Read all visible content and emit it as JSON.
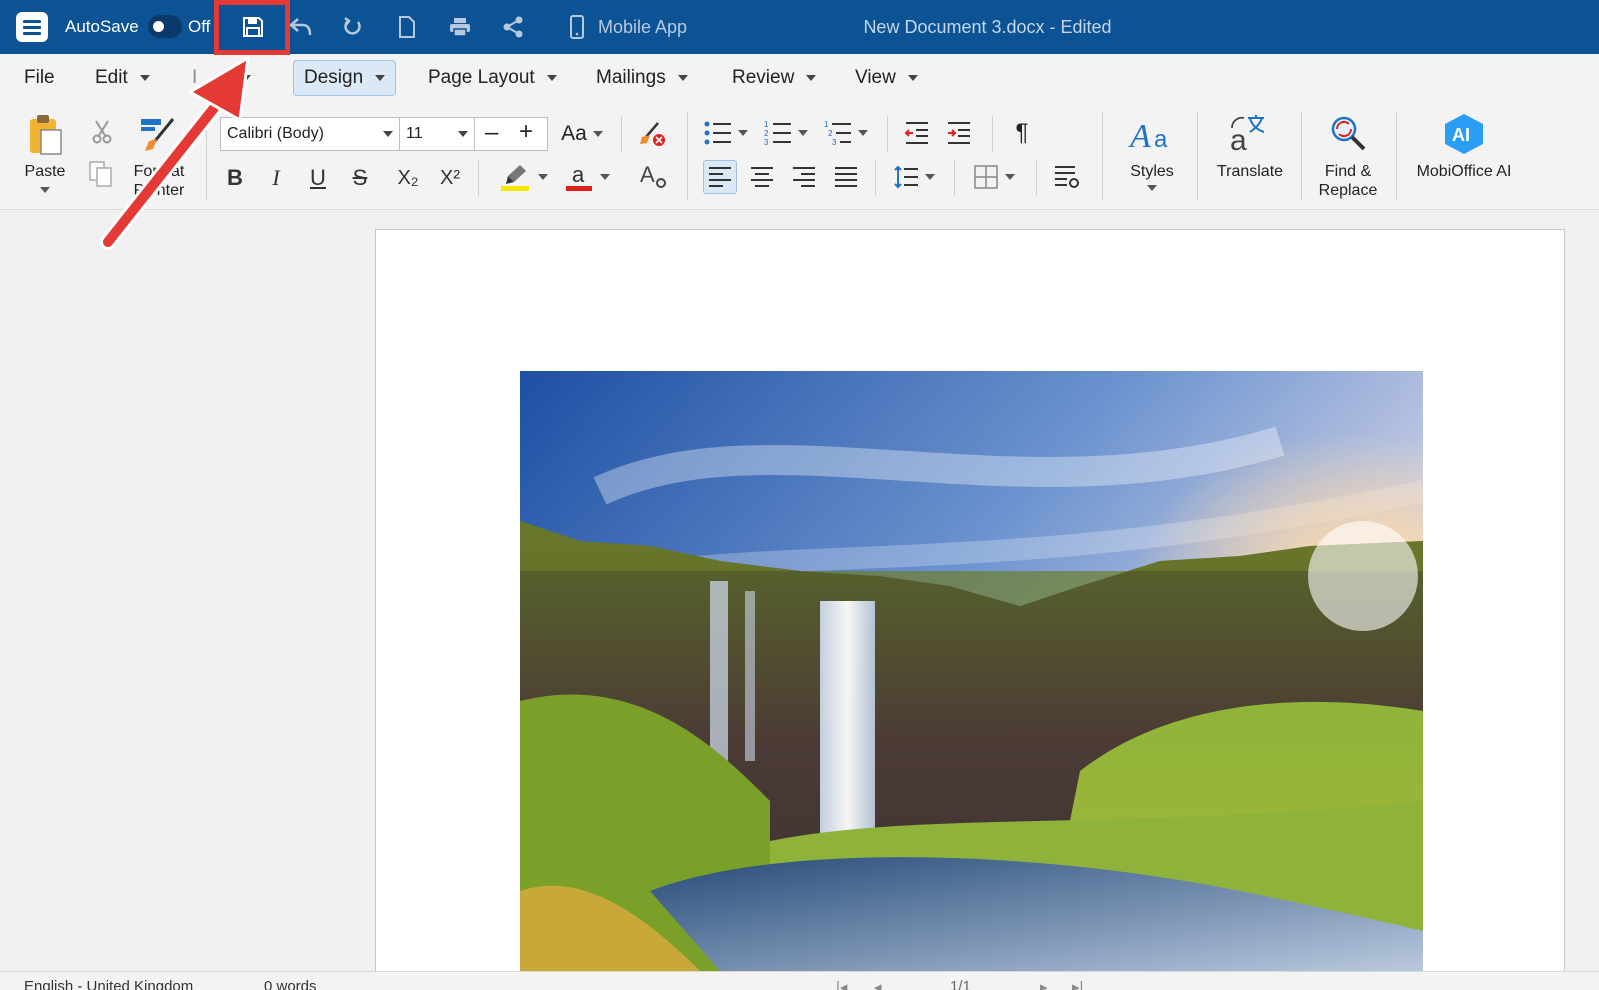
{
  "titlebar": {
    "autosave_label": "AutoSave",
    "autosave_state": "Off",
    "mobile_label": "Mobile App",
    "document_title": "New Document 3.docx - Edited"
  },
  "menu": {
    "items": [
      {
        "label": "File",
        "caret": false
      },
      {
        "label": "Edit",
        "caret": true
      },
      {
        "label": "I",
        "caret": true
      },
      {
        "label": "Design",
        "caret": true,
        "active": true
      },
      {
        "label": "Page Layout",
        "caret": true
      },
      {
        "label": "Mailings",
        "caret": true
      },
      {
        "label": "Review",
        "caret": true
      },
      {
        "label": "View",
        "caret": true
      }
    ]
  },
  "ribbon": {
    "paste_label": "Paste",
    "format_painter_label": "Format\nPainter",
    "font_name": "Calibri (Body)",
    "font_size": "11",
    "change_case_label": "Aa",
    "styles_label": "Styles",
    "translate_label": "Translate",
    "find_replace_label": "Find &\nReplace",
    "ai_label": "MobiOffice AI",
    "ai_badge": "AI",
    "bold": "B",
    "italic": "I",
    "underline": "U",
    "strikethrough": "S",
    "subscript": "X₂",
    "superscript": "X²",
    "highlight_color": "#f5e900",
    "font_color": "#e0201b",
    "pilcrow": "¶"
  },
  "statusbar": {
    "language": "English - United Kingdom",
    "word_count": "0 words",
    "page_indicator": "1/1"
  },
  "colors": {
    "titlebar": "#0b5394",
    "accent": "#1e73c8",
    "annotation": "#e53935"
  }
}
